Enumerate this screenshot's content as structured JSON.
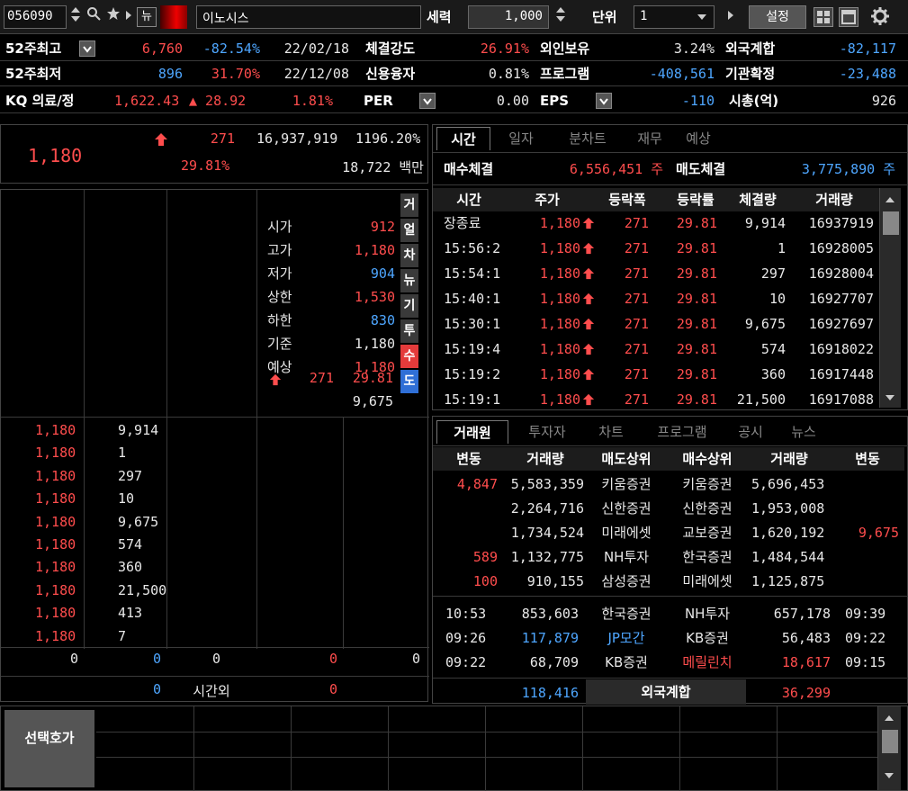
{
  "topbar": {
    "code": "056090",
    "news_label": "뉴",
    "stock_name": "이노시스",
    "force_label": "세력",
    "quantity": "1,000",
    "unit_label": "단위",
    "unit_value": "1",
    "settings_label": "설정"
  },
  "info": {
    "row1": {
      "hi52_label": "52주최고",
      "hi52_price": "6,760",
      "hi52_pct": "-82.54%",
      "hi52_date": "22/02/18",
      "strength_label": "체결강도",
      "strength_val": "26.91%",
      "foreign_label": "외인보유",
      "foreign_val": "3.24%",
      "fsum_label": "외국계합",
      "fsum_val": "-82,117"
    },
    "row2": {
      "lo52_label": "52주최저",
      "lo52_price": "896",
      "lo52_pct": "31.70%",
      "lo52_date": "22/12/08",
      "credit_label": "신용융자",
      "credit_val": "0.81%",
      "program_label": "프로그램",
      "program_val": "-408,561",
      "inst_label": "기관확정",
      "inst_val": "-23,488"
    },
    "row3": {
      "index_label": "KQ 의료/정",
      "index_val": "1,622.43",
      "index_chg": "▲ 28.92",
      "index_pct": "1.81%",
      "per_label": "PER",
      "per_val": "0.00",
      "eps_label": "EPS",
      "eps_val": "-110",
      "mcap_label": "시총(억)",
      "mcap_val": "926"
    }
  },
  "price": {
    "current": "1,180",
    "change": "271",
    "change_pct": "29.81%",
    "volume": "16,937,919",
    "vol_ratio": "1196.20%",
    "amount": "18,722 백만"
  },
  "orderbook": {
    "summary": [
      {
        "label": "시가",
        "value": "912"
      },
      {
        "label": "고가",
        "value": "1,180"
      },
      {
        "label": "저가",
        "value": "904"
      },
      {
        "label": "상한",
        "value": "1,530"
      },
      {
        "label": "하한",
        "value": "830"
      },
      {
        "label": "기준",
        "value": "1,180"
      },
      {
        "label": "예상",
        "value": "1,180"
      }
    ],
    "expected_change": "271",
    "expected_pct": "29.81",
    "expected_vol": "9,675",
    "side_tabs": [
      "거",
      "얼",
      "차",
      "뉴",
      "기",
      "투",
      "수",
      "도"
    ],
    "ticks": [
      {
        "price": "1,180",
        "qty": "9,914"
      },
      {
        "price": "1,180",
        "qty": "1"
      },
      {
        "price": "1,180",
        "qty": "297"
      },
      {
        "price": "1,180",
        "qty": "10"
      },
      {
        "price": "1,180",
        "qty": "9,675"
      },
      {
        "price": "1,180",
        "qty": "574"
      },
      {
        "price": "1,180",
        "qty": "360"
      },
      {
        "price": "1,180",
        "qty": "21,500"
      },
      {
        "price": "1,180",
        "qty": "413"
      },
      {
        "price": "1,180",
        "qty": "7"
      }
    ],
    "totals": [
      "0",
      "0",
      "0",
      "0",
      "0"
    ],
    "after_hours_left": "0",
    "after_hours_label": "시간외",
    "after_hours_right": "0",
    "select_label": "선택호가"
  },
  "trades": {
    "tabs": [
      "시간",
      "일자",
      "분차트",
      "재무",
      "예상"
    ],
    "buy_label": "매수체결",
    "buy_val": "6,556,451 주",
    "sell_label": "매도체결",
    "sell_val": "3,775,890 주",
    "columns": [
      "시간",
      "주가",
      "등락폭",
      "등락률",
      "체결량",
      "거래량"
    ],
    "rows": [
      {
        "time": "장종료",
        "price": "1,180",
        "chg": "271",
        "pct": "29.81",
        "qty": "9,914",
        "vol": "16937919"
      },
      {
        "time": "15:56:2",
        "price": "1,180",
        "chg": "271",
        "pct": "29.81",
        "qty": "1",
        "vol": "16928005"
      },
      {
        "time": "15:54:1",
        "price": "1,180",
        "chg": "271",
        "pct": "29.81",
        "qty": "297",
        "vol": "16928004"
      },
      {
        "time": "15:40:1",
        "price": "1,180",
        "chg": "271",
        "pct": "29.81",
        "qty": "10",
        "vol": "16927707"
      },
      {
        "time": "15:30:1",
        "price": "1,180",
        "chg": "271",
        "pct": "29.81",
        "qty": "9,675",
        "vol": "16927697"
      },
      {
        "time": "15:19:4",
        "price": "1,180",
        "chg": "271",
        "pct": "29.81",
        "qty": "574",
        "vol": "16918022"
      },
      {
        "time": "15:19:2",
        "price": "1,180",
        "chg": "271",
        "pct": "29.81",
        "qty": "360",
        "vol": "16917448"
      },
      {
        "time": "15:19:1",
        "price": "1,180",
        "chg": "271",
        "pct": "29.81",
        "qty": "21,500",
        "vol": "16917088"
      }
    ]
  },
  "brokers": {
    "tabs": [
      "거래원",
      "투자자",
      "차트",
      "프로그램",
      "공시",
      "뉴스"
    ],
    "columns": [
      "변동",
      "거래량",
      "매도상위",
      "매수상위",
      "거래량",
      "변동"
    ],
    "rows": [
      {
        "chg_l": "4,847",
        "vol_l": "5,583,359",
        "sell": "키움증권",
        "buy": "키움증권",
        "vol_r": "5,696,453",
        "chg_r": ""
      },
      {
        "chg_l": "",
        "vol_l": "2,264,716",
        "sell": "신한증권",
        "buy": "신한증권",
        "vol_r": "1,953,008",
        "chg_r": ""
      },
      {
        "chg_l": "",
        "vol_l": "1,734,524",
        "sell": "미래에셋",
        "buy": "교보증권",
        "vol_r": "1,620,192",
        "chg_r": "9,675"
      },
      {
        "chg_l": "589",
        "vol_l": "1,132,775",
        "sell": "NH투자",
        "buy": "한국증권",
        "vol_r": "1,484,544",
        "chg_r": ""
      },
      {
        "chg_l": "100",
        "vol_l": "910,155",
        "sell": "삼성증권",
        "buy": "미래에셋",
        "vol_r": "1,125,875",
        "chg_r": ""
      }
    ],
    "recent": [
      {
        "t1": "10:53",
        "vol_l": "853,603",
        "sell": "한국증권",
        "buy": "NH투자",
        "vol_r": "657,178",
        "t2": "09:39"
      },
      {
        "t1": "09:26",
        "vol_l": "117,879",
        "sell": "JP모간",
        "buy": "KB증권",
        "vol_r": "56,483",
        "t2": "09:22"
      },
      {
        "t1": "09:22",
        "vol_l": "68,709",
        "sell": "KB증권",
        "buy": "메릴린치",
        "vol_r": "18,617",
        "t2": "09:15"
      }
    ],
    "foreign_vol_l": "118,416",
    "foreign_label": "외국계합",
    "foreign_vol_r": "36,299"
  },
  "colors": {
    "up": "#ff4d4d",
    "down": "#4ea6ff",
    "bg": "#000000"
  },
  "icons": [
    "spin-updown-icon",
    "search-icon",
    "star-icon",
    "play-icon",
    "chevron-down-icon",
    "grid-icon",
    "window-icon",
    "gear-icon",
    "up-arrow-icon",
    "scroll-up-icon",
    "scroll-down-icon"
  ]
}
